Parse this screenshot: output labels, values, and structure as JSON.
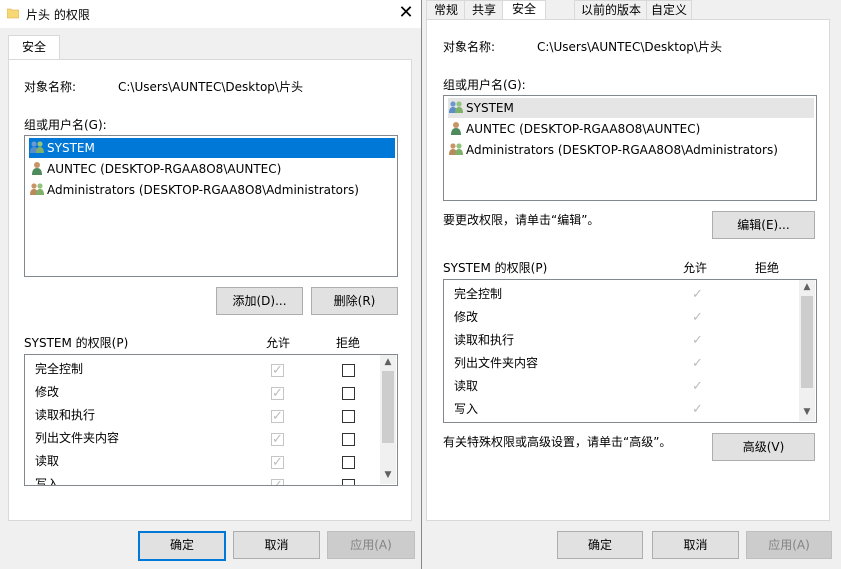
{
  "left": {
    "title": "片头 的权限",
    "tab": "安全",
    "object_label": "对象名称:",
    "object_path": "C:\\Users\\AUNTEC\\Desktop\\片头",
    "group_label": "组或用户名(G):",
    "users": [
      {
        "name": "SYSTEM",
        "icon": "users-group-icon"
      },
      {
        "name": "AUNTEC (DESKTOP-RGAA8O8\\AUNTEC)",
        "icon": "user-icon"
      },
      {
        "name": "Administrators (DESKTOP-RGAA8O8\\Administrators)",
        "icon": "users-group-icon"
      }
    ],
    "add_button": "添加(D)...",
    "remove_button": "删除(R)",
    "perm_title": "SYSTEM 的权限(P)",
    "allow_header": "允许",
    "deny_header": "拒绝",
    "permissions": [
      "完全控制",
      "修改",
      "读取和执行",
      "列出文件夹内容",
      "读取",
      "写入"
    ],
    "ok_button": "确定",
    "cancel_button": "取消",
    "apply_button": "应用(A)"
  },
  "right": {
    "tabs": [
      "常规",
      "共享",
      "安全",
      "以前的版本",
      "自定义"
    ],
    "active_tab": "安全",
    "object_label": "对象名称:",
    "object_path": "C:\\Users\\AUNTEC\\Desktop\\片头",
    "group_label": "组或用户名(G):",
    "users": [
      {
        "name": "SYSTEM",
        "icon": "users-group-icon"
      },
      {
        "name": "AUNTEC (DESKTOP-RGAA8O8\\AUNTEC)",
        "icon": "user-icon"
      },
      {
        "name": "Administrators (DESKTOP-RGAA8O8\\Administrators)",
        "icon": "users-group-icon"
      }
    ],
    "edit_hint": "要更改权限，请单击“编辑”。",
    "edit_button": "编辑(E)...",
    "perm_title": "SYSTEM 的权限(P)",
    "allow_header": "允许",
    "deny_header": "拒绝",
    "permissions": [
      "完全控制",
      "修改",
      "读取和执行",
      "列出文件夹内容",
      "读取",
      "写入"
    ],
    "advanced_hint": "有关特殊权限或高级设置，请单击“高级”。",
    "advanced_button": "高级(V)",
    "ok_button": "确定",
    "cancel_button": "取消",
    "apply_button": "应用(A)"
  }
}
